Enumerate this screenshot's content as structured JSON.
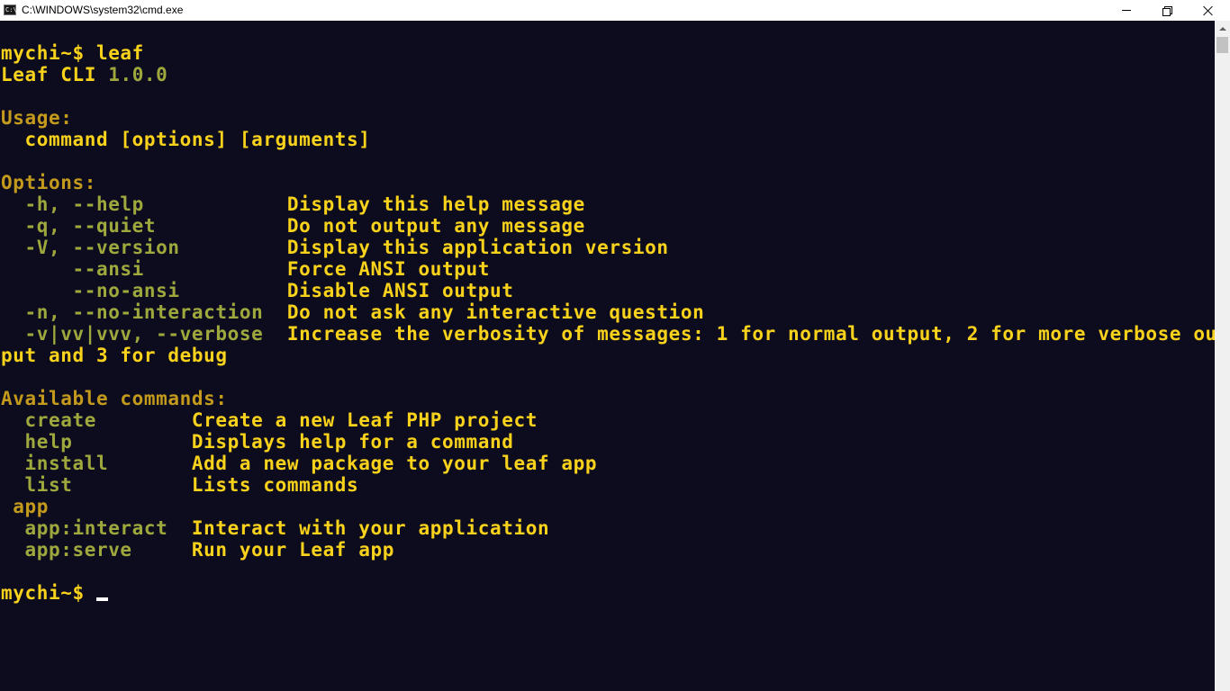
{
  "window": {
    "title": "C:\\WINDOWS\\system32\\cmd.exe",
    "icon": "cmd-icon",
    "icon_text": "C:\\",
    "buttons": [
      "minimize",
      "restore",
      "close"
    ]
  },
  "colors": {
    "background": "#0c0c1e",
    "bright_yellow": "#f9d21b",
    "dark_yellow": "#c49a1c",
    "green": "#9ea83d"
  },
  "console": {
    "prompt_command": "mychi~$ leaf",
    "app_name": "Leaf CLI",
    "app_version": "1.0.0",
    "usage_header": "Usage:",
    "usage_line": "  command [options] [arguments]",
    "options_header": "Options:",
    "options": [
      {
        "flag": "  -h, --help            ",
        "desc": "Display this help message"
      },
      {
        "flag": "  -q, --quiet           ",
        "desc": "Do not output any message"
      },
      {
        "flag": "  -V, --version         ",
        "desc": "Display this application version"
      },
      {
        "flag": "      --ansi            ",
        "desc": "Force ANSI output"
      },
      {
        "flag": "      --no-ansi         ",
        "desc": "Disable ANSI output"
      },
      {
        "flag": "  -n, --no-interaction  ",
        "desc": "Do not ask any interactive question"
      },
      {
        "flag": "  -v|vv|vvv, --verbose  ",
        "desc": "Increase the verbosity of messages: 1 for normal output, 2 for more verbose out"
      }
    ],
    "verbose_wrap": "put and 3 for debug",
    "commands_header": "Available commands:",
    "commands": [
      {
        "name": "  create        ",
        "desc": "Create a new Leaf PHP project"
      },
      {
        "name": "  help          ",
        "desc": "Displays help for a command"
      },
      {
        "name": "  install       ",
        "desc": "Add a new package to your leaf app"
      },
      {
        "name": "  list          ",
        "desc": "Lists commands"
      }
    ],
    "group_header": " app",
    "group_commands": [
      {
        "name": "  app:interact  ",
        "desc": "Interact with your application"
      },
      {
        "name": "  app:serve     ",
        "desc": "Run your Leaf app"
      }
    ],
    "prompt_final": "mychi~$ "
  }
}
